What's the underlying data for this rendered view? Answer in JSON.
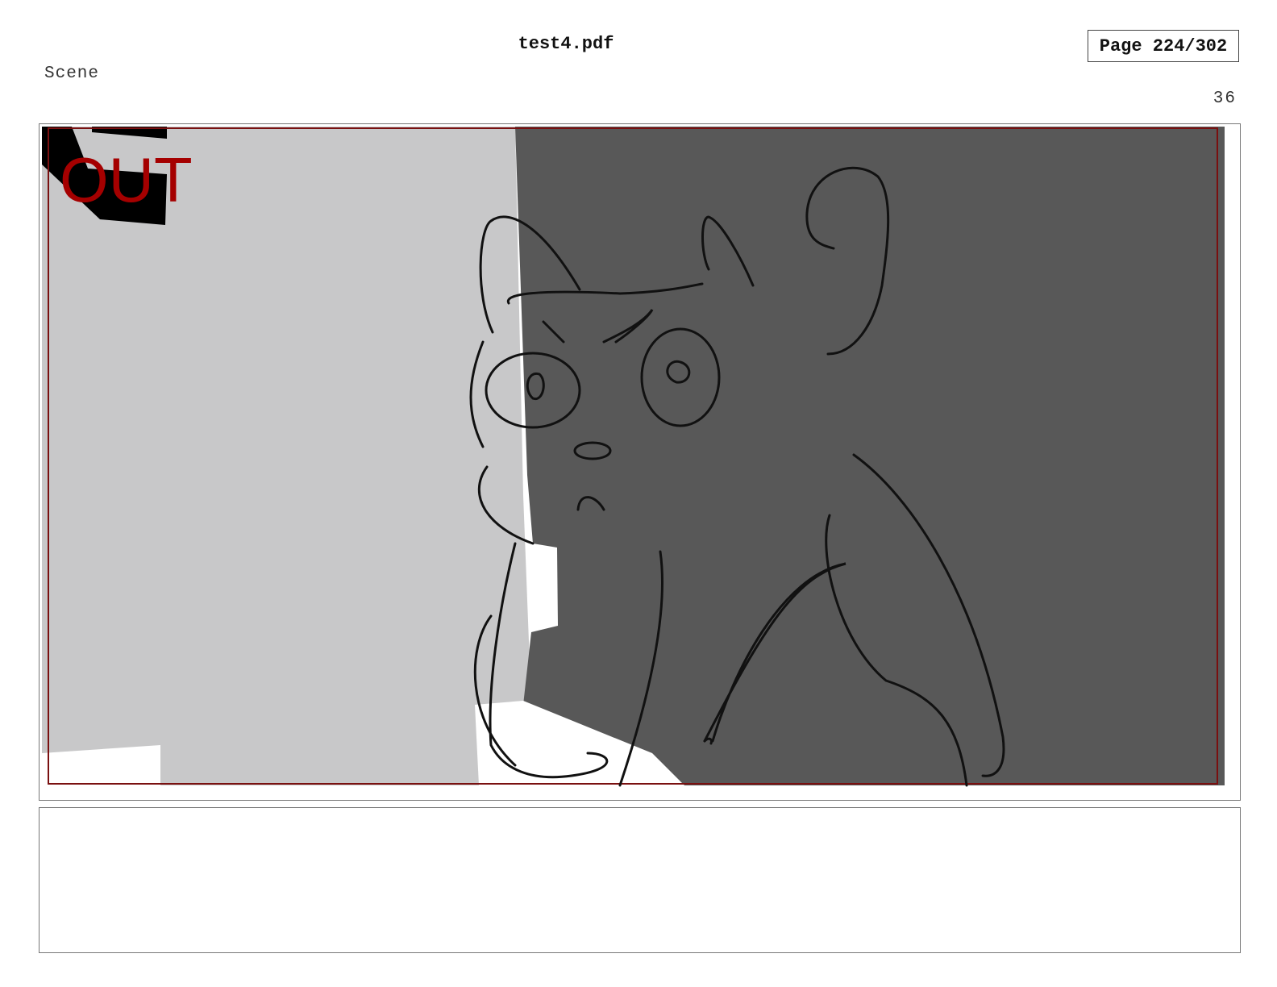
{
  "document": {
    "title": "test4.pdf",
    "page_indicator": "Page 224/302"
  },
  "scene": {
    "label": "Scene",
    "number": "36"
  },
  "panel": {
    "stamp_text": "OUT",
    "stamp_color": "#a50000",
    "safe_area_color": "#7a1010",
    "background_light": "#c8c8c9",
    "background_dark": "#585858",
    "sketch_stroke": "#111111",
    "description": ""
  }
}
